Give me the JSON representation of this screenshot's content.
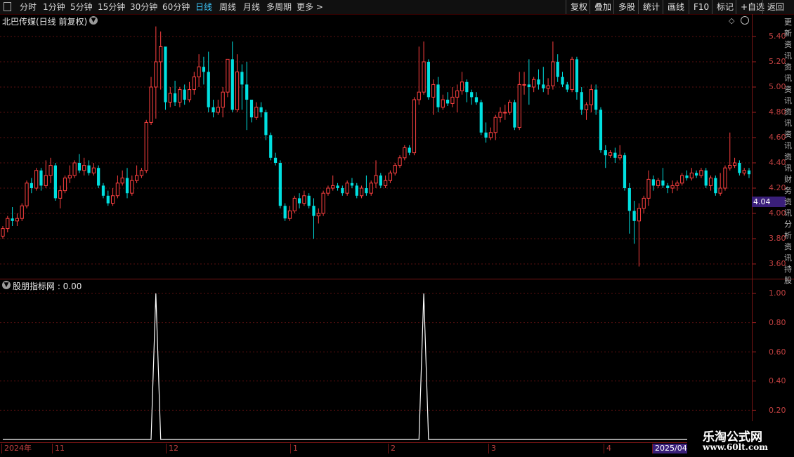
{
  "toolbar": {
    "periods": [
      {
        "label": "分时",
        "active": false
      },
      {
        "label": "1分钟",
        "active": false
      },
      {
        "label": "5分钟",
        "active": false
      },
      {
        "label": "15分钟",
        "active": false
      },
      {
        "label": "30分钟",
        "active": false
      },
      {
        "label": "60分钟",
        "active": false
      },
      {
        "label": "日线",
        "active": true
      },
      {
        "label": "周线",
        "active": false
      },
      {
        "label": "月线",
        "active": false
      },
      {
        "label": "多周期",
        "active": false
      },
      {
        "label": "更多 >",
        "active": false
      }
    ],
    "right_buttons": [
      "复权",
      "叠加",
      "多股",
      "统计",
      "画线",
      "F10",
      "标记",
      "+自选",
      "返回"
    ]
  },
  "chart": {
    "title": "北巴传媒(日线 前复权)",
    "price_ticks": [
      "5.40",
      "5.20",
      "5.00",
      "4.80",
      "4.60",
      "4.40",
      "4.20",
      "4.00",
      "3.80",
      "3.60"
    ],
    "current_price": "4.04",
    "right_strip_text": "更新资讯资讯资讯资讯资讯资讯财务资讯分析资讯持股"
  },
  "indicator": {
    "title": "股朋指标网 : 0.00",
    "ticks": [
      "1.00",
      "0.80",
      "0.60",
      "0.40",
      "0.20"
    ]
  },
  "x_axis": {
    "labels": [
      "2024年",
      "11",
      "12",
      "1",
      "2",
      "3",
      "4",
      "2025/04/"
    ]
  },
  "watermark": {
    "line1": "乐淘公式网",
    "line2": "www.60lt.com"
  },
  "colors": {
    "up": "#ff4040",
    "down": "#00e0e0",
    "grid": "#5a1010",
    "accent": "#3ec9ff",
    "price_tag": "#3a1f7a"
  },
  "chart_data": {
    "type": "candlestick",
    "title": "北巴传媒(日线 前复权)",
    "ylim": [
      3.55,
      5.5
    ],
    "candles": [
      [
        3.82,
        3.88,
        3.8,
        3.9
      ],
      [
        3.88,
        3.96,
        3.85,
        3.98
      ],
      [
        3.96,
        3.94,
        3.9,
        4.05
      ],
      [
        3.94,
        3.96,
        3.9,
        4.0
      ],
      [
        3.96,
        4.06,
        3.94,
        4.08
      ],
      [
        4.06,
        4.24,
        4.04,
        4.26
      ],
      [
        4.24,
        4.2,
        4.16,
        4.28
      ],
      [
        4.2,
        4.34,
        4.18,
        4.36
      ],
      [
        4.34,
        4.22,
        4.18,
        4.36
      ],
      [
        4.22,
        4.3,
        4.2,
        4.42
      ],
      [
        4.3,
        4.38,
        4.24,
        4.44
      ],
      [
        4.38,
        4.12,
        4.1,
        4.4
      ],
      [
        4.12,
        4.18,
        4.04,
        4.22
      ],
      [
        4.18,
        4.28,
        4.16,
        4.3
      ],
      [
        4.28,
        4.3,
        4.24,
        4.38
      ],
      [
        4.3,
        4.4,
        4.28,
        4.42
      ],
      [
        4.4,
        4.34,
        4.32,
        4.47
      ],
      [
        4.34,
        4.38,
        4.3,
        4.44
      ],
      [
        4.38,
        4.32,
        4.3,
        4.42
      ],
      [
        4.32,
        4.36,
        4.3,
        4.4
      ],
      [
        4.36,
        4.22,
        4.2,
        4.38
      ],
      [
        4.22,
        4.14,
        4.12,
        4.24
      ],
      [
        4.14,
        4.08,
        4.06,
        4.18
      ],
      [
        4.08,
        4.14,
        4.06,
        4.2
      ],
      [
        4.14,
        4.24,
        4.12,
        4.3
      ],
      [
        4.24,
        4.28,
        4.22,
        4.34
      ],
      [
        4.28,
        4.16,
        4.12,
        4.36
      ],
      [
        4.16,
        4.26,
        4.14,
        4.3
      ],
      [
        4.26,
        4.3,
        4.24,
        4.38
      ],
      [
        4.3,
        4.34,
        4.28,
        4.36
      ],
      [
        4.34,
        4.72,
        4.32,
        4.74
      ],
      [
        4.72,
        5.0,
        4.7,
        5.08
      ],
      [
        5.0,
        5.2,
        4.75,
        5.48
      ],
      [
        5.2,
        5.32,
        4.98,
        5.44
      ],
      [
        5.32,
        4.88,
        4.82,
        5.22
      ],
      [
        4.88,
        4.95,
        4.84,
        5.0
      ],
      [
        4.95,
        4.88,
        4.85,
        5.05
      ],
      [
        4.88,
        4.98,
        4.84,
        5.0
      ],
      [
        4.98,
        4.9,
        4.86,
        5.02
      ],
      [
        4.9,
        4.98,
        4.88,
        5.04
      ],
      [
        4.98,
        5.08,
        4.94,
        5.12
      ],
      [
        5.08,
        5.16,
        5.0,
        5.26
      ],
      [
        5.16,
        5.12,
        5.02,
        5.24
      ],
      [
        5.12,
        4.84,
        4.8,
        5.28
      ],
      [
        4.84,
        4.8,
        4.76,
        4.9
      ],
      [
        4.8,
        4.84,
        4.78,
        4.9
      ],
      [
        4.84,
        4.96,
        4.76,
        5.0
      ],
      [
        4.96,
        5.22,
        4.92,
        5.22
      ],
      [
        5.22,
        4.82,
        4.8,
        5.36
      ],
      [
        4.82,
        5.12,
        4.8,
        5.26
      ],
      [
        5.12,
        5.02,
        4.82,
        5.18
      ],
      [
        5.02,
        4.9,
        4.66,
        5.2
      ],
      [
        4.9,
        4.76,
        4.72,
        4.86
      ],
      [
        4.76,
        4.84,
        4.74,
        4.88
      ],
      [
        4.84,
        4.8,
        4.76,
        4.88
      ],
      [
        4.8,
        4.62,
        4.58,
        4.82
      ],
      [
        4.62,
        4.44,
        4.42,
        4.64
      ],
      [
        4.44,
        4.4,
        4.38,
        4.48
      ],
      [
        4.4,
        4.06,
        4.04,
        4.42
      ],
      [
        4.06,
        3.96,
        3.94,
        4.08
      ],
      [
        3.96,
        4.02,
        3.94,
        4.06
      ],
      [
        4.02,
        4.12,
        4.0,
        4.14
      ],
      [
        4.12,
        4.08,
        4.04,
        4.16
      ],
      [
        4.08,
        4.14,
        4.06,
        4.18
      ],
      [
        4.14,
        4.06,
        4.04,
        4.16
      ],
      [
        4.06,
        3.98,
        3.8,
        4.12
      ],
      [
        3.98,
        4.0,
        3.92,
        4.04
      ],
      [
        4.0,
        4.16,
        3.98,
        4.18
      ],
      [
        4.16,
        4.2,
        4.14,
        4.22
      ],
      [
        4.2,
        4.22,
        4.18,
        4.3
      ],
      [
        4.22,
        4.2,
        4.18,
        4.24
      ],
      [
        4.2,
        4.16,
        4.14,
        4.22
      ],
      [
        4.16,
        4.24,
        4.14,
        4.26
      ],
      [
        4.24,
        4.22,
        4.2,
        4.28
      ],
      [
        4.22,
        4.14,
        4.12,
        4.24
      ],
      [
        4.14,
        4.2,
        4.12,
        4.22
      ],
      [
        4.2,
        4.16,
        4.14,
        4.3
      ],
      [
        4.16,
        4.24,
        4.14,
        4.26
      ],
      [
        4.24,
        4.3,
        4.2,
        4.42
      ],
      [
        4.3,
        4.22,
        4.2,
        4.32
      ],
      [
        4.22,
        4.26,
        4.2,
        4.3
      ],
      [
        4.26,
        4.32,
        4.24,
        4.34
      ],
      [
        4.32,
        4.38,
        4.3,
        4.4
      ],
      [
        4.38,
        4.44,
        4.36,
        4.46
      ],
      [
        4.44,
        4.52,
        4.42,
        4.54
      ],
      [
        4.52,
        4.48,
        4.46,
        4.54
      ],
      [
        4.48,
        4.9,
        4.46,
        4.92
      ],
      [
        4.9,
        4.96,
        4.86,
        5.32
      ],
      [
        4.96,
        5.2,
        4.94,
        5.36
      ],
      [
        5.2,
        4.92,
        4.9,
        5.22
      ],
      [
        4.92,
        5.02,
        4.78,
        5.06
      ],
      [
        5.02,
        4.84,
        4.8,
        5.08
      ],
      [
        4.84,
        4.9,
        4.82,
        4.94
      ],
      [
        4.9,
        4.87,
        4.85,
        4.96
      ],
      [
        4.87,
        4.92,
        4.84,
        5.0
      ],
      [
        4.92,
        4.97,
        4.8,
        5.02
      ],
      [
        4.97,
        5.04,
        4.94,
        5.12
      ],
      [
        5.04,
        4.96,
        4.88,
        5.06
      ],
      [
        4.96,
        4.92,
        4.86,
        4.98
      ],
      [
        4.92,
        4.88,
        4.86,
        4.96
      ],
      [
        4.88,
        4.64,
        4.62,
        4.9
      ],
      [
        4.64,
        4.6,
        4.56,
        4.72
      ],
      [
        4.6,
        4.64,
        4.58,
        4.68
      ],
      [
        4.64,
        4.76,
        4.58,
        4.78
      ],
      [
        4.76,
        4.8,
        4.72,
        4.84
      ],
      [
        4.8,
        4.8,
        4.74,
        4.86
      ],
      [
        4.8,
        4.88,
        4.78,
        4.9
      ],
      [
        4.88,
        4.68,
        4.66,
        4.9
      ],
      [
        4.68,
        5.02,
        4.66,
        5.12
      ],
      [
        5.02,
        5.02,
        4.94,
        5.12
      ],
      [
        5.02,
        5.0,
        4.86,
        5.22
      ],
      [
        5.0,
        5.06,
        4.96,
        5.08
      ],
      [
        5.06,
        5.02,
        4.98,
        5.14
      ],
      [
        5.02,
        4.99,
        4.96,
        5.16
      ],
      [
        4.99,
        5.01,
        4.94,
        5.07
      ],
      [
        5.01,
        5.2,
        4.98,
        5.36
      ],
      [
        5.2,
        5.08,
        5.04,
        5.26
      ],
      [
        5.08,
        5.02,
        5.0,
        5.12
      ],
      [
        5.02,
        4.98,
        4.96,
        5.04
      ],
      [
        4.98,
        5.22,
        4.96,
        5.24
      ],
      [
        5.22,
        4.96,
        4.9,
        5.24
      ],
      [
        4.96,
        4.82,
        4.78,
        5.0
      ],
      [
        4.82,
        4.86,
        4.74,
        4.88
      ],
      [
        4.86,
        4.98,
        4.8,
        5.02
      ],
      [
        4.98,
        4.82,
        4.78,
        5.02
      ],
      [
        4.82,
        4.5,
        4.48,
        4.84
      ],
      [
        4.5,
        4.46,
        4.36,
        4.54
      ],
      [
        4.46,
        4.48,
        4.44,
        4.5
      ],
      [
        4.48,
        4.44,
        4.4,
        4.52
      ],
      [
        4.44,
        4.46,
        4.42,
        4.54
      ],
      [
        4.46,
        4.2,
        4.18,
        4.48
      ],
      [
        4.2,
        4.02,
        3.84,
        4.24
      ],
      [
        4.02,
        3.94,
        3.76,
        4.1
      ],
      [
        3.94,
        4.04,
        3.58,
        4.08
      ],
      [
        4.04,
        4.12,
        4.0,
        4.14
      ],
      [
        4.12,
        4.27,
        4.06,
        4.34
      ],
      [
        4.27,
        4.22,
        4.18,
        4.3
      ],
      [
        4.22,
        4.26,
        4.2,
        4.28
      ],
      [
        4.26,
        4.22,
        4.2,
        4.36
      ],
      [
        4.22,
        4.2,
        4.16,
        4.24
      ],
      [
        4.2,
        4.22,
        4.16,
        4.26
      ],
      [
        4.22,
        4.24,
        4.18,
        4.26
      ],
      [
        4.24,
        4.3,
        4.22,
        4.32
      ],
      [
        4.3,
        4.28,
        4.26,
        4.34
      ],
      [
        4.28,
        4.32,
        4.26,
        4.36
      ],
      [
        4.32,
        4.3,
        4.28,
        4.34
      ],
      [
        4.3,
        4.34,
        4.28,
        4.36
      ],
      [
        4.34,
        4.22,
        4.2,
        4.36
      ],
      [
        4.22,
        4.28,
        4.18,
        4.3
      ],
      [
        4.28,
        4.16,
        4.14,
        4.3
      ],
      [
        4.16,
        4.2,
        4.14,
        4.32
      ],
      [
        4.2,
        4.36,
        4.18,
        4.38
      ],
      [
        4.36,
        4.38,
        4.34,
        4.64
      ],
      [
        4.38,
        4.4,
        4.36,
        4.44
      ],
      [
        4.4,
        4.32,
        4.3,
        4.42
      ],
      [
        4.32,
        4.34,
        4.3,
        4.36
      ],
      [
        4.34,
        4.31,
        4.28,
        4.36
      ]
    ],
    "indicator_series": {
      "name": "股朋指标网",
      "peaks_at_index": [
        32,
        88
      ],
      "peak_value": 1.0,
      "base_value": 0.0,
      "ylim": [
        0,
        1.05
      ]
    }
  }
}
